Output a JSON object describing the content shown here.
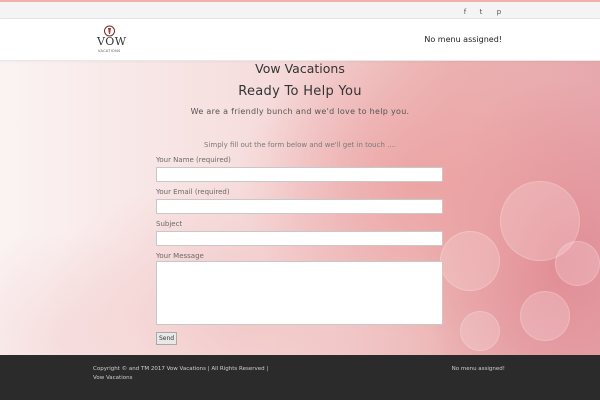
{
  "topbar": {
    "social": [
      {
        "name": "facebook",
        "glyph": "f"
      },
      {
        "name": "twitter",
        "glyph": "t"
      },
      {
        "name": "pinterest",
        "glyph": "p"
      }
    ]
  },
  "header": {
    "logo": {
      "text": "VOW",
      "subtext": "VACATIONS"
    },
    "menu_note": "No menu assigned!"
  },
  "main": {
    "site_title": "Vow Vacations",
    "heading": "Ready To Help You",
    "tagline": "We are a friendly bunch and we'd love to help you.",
    "intro": "Simply fill out the form below and we'll get in touch ....",
    "form": {
      "name_label": "Your Name (required)",
      "email_label": "Your Email (required)",
      "subject_label": "Subject",
      "message_label": "Your Message",
      "send_label": "Send",
      "name_value": "",
      "email_value": "",
      "subject_value": "",
      "message_value": ""
    }
  },
  "footer": {
    "copyright_line1": "Copyright © and TM 2017 Vow Vacations | All Rights Reserved |",
    "copyright_line2": "Vow Vacations",
    "menu_note": "No menu assigned!"
  },
  "colors": {
    "accent_line": "#f1b0a8",
    "footer_bg": "#2b2b2b"
  }
}
